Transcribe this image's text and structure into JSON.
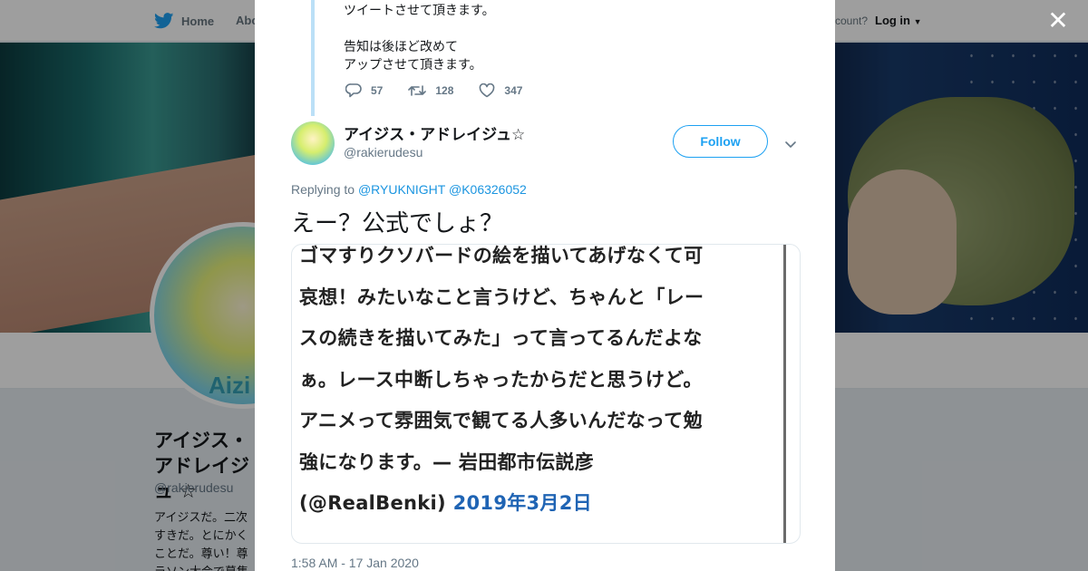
{
  "topnav": {
    "home_label": "Home",
    "about_label": "Abo",
    "account_prompt": "ccount?",
    "login_label": "Log in"
  },
  "profile": {
    "name": "アイジス・アドレイジュ ☆",
    "handle": "@rakierudesu",
    "avatar_text": "Aizi",
    "bio": "アイジスだ。二次 すきだ。とにかく ことだ。尊い！尊 ラソン大会で募集"
  },
  "thread": {
    "previous_text": "ツイートさせて頂きます。\n\n告知は後ほど改めて\nアップさせて頂きます。",
    "previous_actions": {
      "replies": "57",
      "retweets": "128",
      "likes": "347"
    }
  },
  "tweet": {
    "author_name": "アイジス・アドレイジュ☆",
    "author_handle": "@rakierudesu",
    "follow_label": "Follow",
    "replying_to_label": "Replying to",
    "mentions": [
      "@RYUKNIGHT",
      "@K06326052"
    ],
    "text": "えー？公式でしょ？",
    "media_lines": [
      "ゴマすりクソバードの絵を描いてあげなくて可",
      "哀想！みたいなこと言うけど、ちゃんと「レー",
      "スの続きを描いてみた」って言ってるんだよな",
      "ぁ。レース中断しちゃったからだと思うけど。",
      "アニメって雰囲気で観てる人多いんだなって勉",
      "強になります。— 岩田都市伝説彦",
      "(@RealBenki)"
    ],
    "media_link_text": "2019年3月2日",
    "timestamp": "1:58 AM - 17 Jan 2020"
  },
  "colors": {
    "twitter_blue": "#1da1f2",
    "link_blue": "#1b95e0",
    "thread_line": "#bbe0f7",
    "muted_text": "#657786"
  },
  "icons": [
    "twitter-bird-icon",
    "close-icon",
    "reply-icon",
    "retweet-icon",
    "like-icon",
    "chevron-down-icon",
    "caret-down-icon"
  ]
}
